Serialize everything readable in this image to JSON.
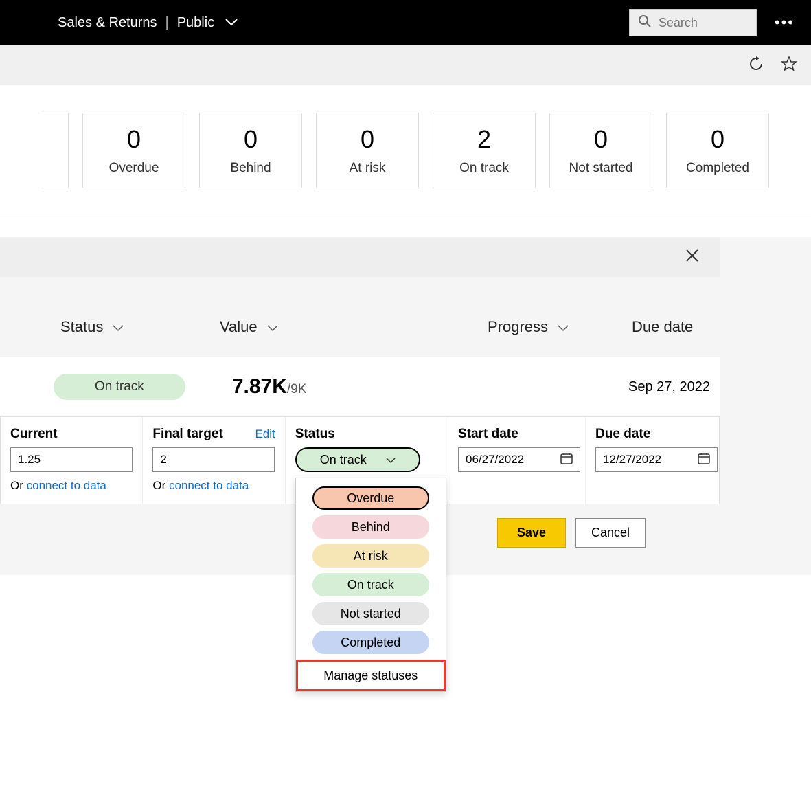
{
  "topbar": {
    "title": "Sales & Returns",
    "visibility": "Public",
    "search_placeholder": "Search"
  },
  "tiles": [
    {
      "count": "0",
      "label": "Overdue"
    },
    {
      "count": "0",
      "label": "Behind"
    },
    {
      "count": "0",
      "label": "At risk"
    },
    {
      "count": "2",
      "label": "On track"
    },
    {
      "count": "0",
      "label": "Not started"
    },
    {
      "count": "0",
      "label": "Completed"
    }
  ],
  "columns": {
    "status": "Status",
    "value": "Value",
    "progress": "Progress",
    "due": "Due date"
  },
  "row": {
    "status": "On track",
    "value": "7.87K",
    "value_denom": "/9K",
    "due": "Sep 27, 2022"
  },
  "form": {
    "current_label": "Current",
    "current_value": "1.25",
    "target_label": "Final target",
    "target_value": "2",
    "edit_label": "Edit",
    "or_text": "Or ",
    "connect_text": "connect to data",
    "status_label": "Status",
    "status_selected": "On track",
    "start_label": "Start date",
    "start_value": "06/27/2022",
    "due_label": "Due date",
    "due_value": "12/27/2022"
  },
  "status_options": {
    "overdue": "Overdue",
    "behind": "Behind",
    "atrisk": "At risk",
    "ontrack": "On track",
    "nostart": "Not started",
    "complete": "Completed",
    "manage": "Manage statuses"
  },
  "actions": {
    "save": "Save",
    "cancel": "Cancel"
  }
}
